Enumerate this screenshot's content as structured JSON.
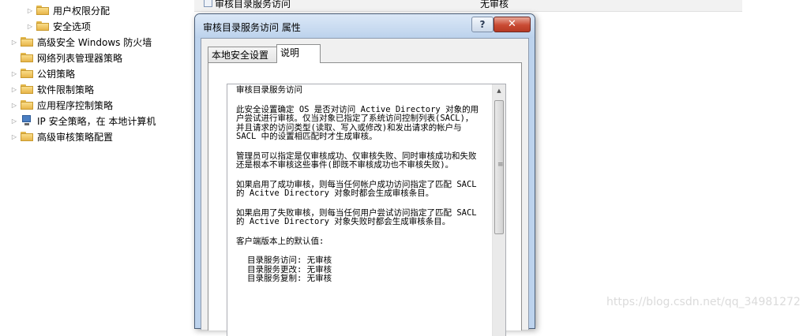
{
  "tree": {
    "items": [
      {
        "label": "用户权限分配",
        "icon": "folder-icon"
      },
      {
        "label": "安全选项",
        "icon": "folder-icon"
      },
      {
        "label": "高级安全 Windows 防火墙",
        "icon": "folder-icon"
      },
      {
        "label": "网络列表管理器策略",
        "icon": "folder-icon"
      },
      {
        "label": "公钥策略",
        "icon": "folder-icon"
      },
      {
        "label": "软件限制策略",
        "icon": "folder-icon"
      },
      {
        "label": "应用程序控制策略",
        "icon": "folder-icon"
      },
      {
        "label": "IP 安全策略，在 本地计算机",
        "icon": "network-icon"
      },
      {
        "label": "高级审核策略配置",
        "icon": "folder-icon"
      }
    ]
  },
  "background_list": {
    "item_name": "审核目录服务访问",
    "item_value": "无审核"
  },
  "dialog": {
    "title": "审核目录服务访问 属性",
    "help_label": "?",
    "close_label": "✕",
    "tabs": [
      "本地安全设置",
      "说明"
    ],
    "explain": {
      "heading": "审核目录服务访问",
      "paragraphs": [
        "此安全设置确定 OS 是否对访问 Active Directory 对象的用户尝试进行审核。仅当对象已指定了系统访问控制列表(SACL)，并且请求的访问类型(读取、写入或修改)和发出请求的帐户与 SACL 中的设置相匹配时才生成审核。",
        "管理员可以指定是仅审核成功、仅审核失败、同时审核成功和失败还是根本不审核这些事件(即既不审核成功也不审核失败)。",
        "如果启用了成功审核，则每当任何帐户成功访问指定了匹配 SACL 的 Acitve Directory 对象时都会生成审核条目。",
        "如果启用了失败审核，则每当任何用户尝试访问指定了匹配 SACL 的 Active Directory 对象失败时都会生成审核条目。"
      ],
      "defaults_heading": "客户端版本上的默认值:",
      "defaults": [
        "目录服务访问: 无审核",
        "目录服务更改: 无审核",
        "目录服务复制: 无审核"
      ]
    }
  },
  "watermark": "https://blog.csdn.net/qq_34981272"
}
